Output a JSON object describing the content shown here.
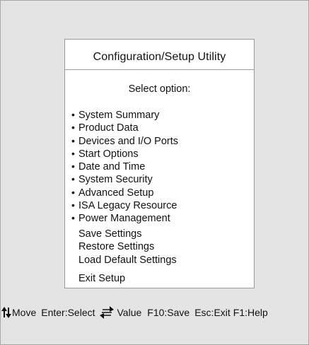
{
  "dialog": {
    "title": "Configuration/Setup Utility",
    "prompt": "Select option:"
  },
  "menu": {
    "bullet": "•",
    "items": [
      {
        "label": "System Summary"
      },
      {
        "label": "Product Data"
      },
      {
        "label": "Devices and I/O Ports"
      },
      {
        "label": "Start Options"
      },
      {
        "label": "Date and Time"
      },
      {
        "label": "System Security"
      },
      {
        "label": "Advanced Setup"
      },
      {
        "label": "ISA Legacy Resource"
      },
      {
        "label": "Power Management"
      }
    ]
  },
  "actions": {
    "save": "Save Settings",
    "restore": "Restore Settings",
    "load_default": "Load Default Settings",
    "exit": "Exit Setup"
  },
  "status_bar": {
    "move": "Move",
    "enter": "Enter:Select",
    "value": "Value",
    "f10": "F10:Save",
    "esc": "Esc:Exit",
    "f1": "F1:Help",
    "icons": [
      "up-down-arrows-icon",
      "value-change-arrows-icon"
    ]
  },
  "colors": {
    "background": "#e4e4e4",
    "dialog_background": "#ffffff",
    "border": "#9a9a9a",
    "text": "#111111"
  }
}
